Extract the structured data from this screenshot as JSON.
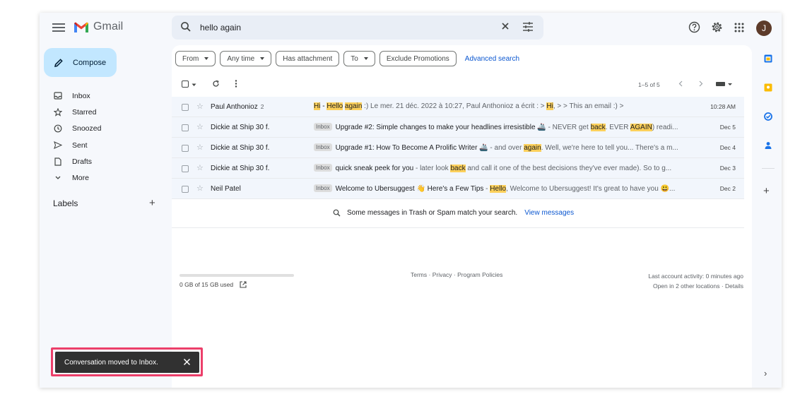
{
  "header": {
    "app_name": "Gmail",
    "search_value": "hello again",
    "avatar_letter": "J",
    "icons": [
      "menu-icon",
      "search-icon",
      "clear-search-icon",
      "search-options-icon",
      "help-icon",
      "settings-icon",
      "apps-icon"
    ]
  },
  "compose": {
    "label": "Compose"
  },
  "nav": {
    "items": [
      {
        "label": "Inbox",
        "icon": "inbox-icon"
      },
      {
        "label": "Starred",
        "icon": "star-icon"
      },
      {
        "label": "Snoozed",
        "icon": "clock-icon"
      },
      {
        "label": "Sent",
        "icon": "send-icon"
      },
      {
        "label": "Drafts",
        "icon": "draft-icon"
      },
      {
        "label": "More",
        "icon": "chevron-down-icon"
      }
    ],
    "labels_heading": "Labels",
    "labels_add": "+"
  },
  "filters": {
    "from": "From",
    "any_time": "Any time",
    "has_attachment": "Has attachment",
    "to": "To",
    "exclude_promotions": "Exclude Promotions",
    "advanced_search": "Advanced search"
  },
  "toolbar": {
    "pager": "1–5 of 5"
  },
  "emails": [
    {
      "sender": "Paul Anthonioz",
      "count": "2",
      "tag": "",
      "parts": [
        [
          "hl",
          "Hi"
        ],
        [
          "",
          " - "
        ],
        [
          "hl",
          "Hello"
        ],
        [
          "",
          " "
        ],
        [
          "hl",
          "again"
        ],
        [
          "snip",
          " :) Le mer. 21 déc. 2022 à 10:27, Paul Anthonioz a écrit : > "
        ],
        [
          "hl",
          "Hi"
        ],
        [
          "snip",
          ", > > This an email :) >"
        ]
      ],
      "date": "10:28 AM"
    },
    {
      "sender": "Dickie at Ship 30 f.",
      "count": "",
      "tag": "Inbox",
      "parts": [
        [
          "",
          "Upgrade #2: Simple changes to make your headlines irresistible 🚢"
        ],
        [
          "snip",
          " - NEVER get "
        ],
        [
          "hl",
          "back"
        ],
        [
          "snip",
          ". EVER "
        ],
        [
          "hl",
          "AGAIN"
        ],
        [
          "snip",
          ") readi..."
        ]
      ],
      "date": "Dec 5"
    },
    {
      "sender": "Dickie at Ship 30 f.",
      "count": "",
      "tag": "Inbox",
      "parts": [
        [
          "",
          "Upgrade #1: How To Become A Prolific Writer 🚢"
        ],
        [
          "snip",
          " - and over "
        ],
        [
          "hl",
          "again"
        ],
        [
          "snip",
          ". Well, we're here to tell you... There's a m..."
        ]
      ],
      "date": "Dec 4"
    },
    {
      "sender": "Dickie at Ship 30 f.",
      "count": "",
      "tag": "Inbox",
      "parts": [
        [
          "",
          "quick sneak peek for you"
        ],
        [
          "snip",
          " - later look "
        ],
        [
          "hl",
          "back"
        ],
        [
          "snip",
          " and call it one of the best decisions they've ever made). So to g..."
        ]
      ],
      "date": "Dec 3"
    },
    {
      "sender": "Neil Patel",
      "count": "",
      "tag": "Inbox",
      "parts": [
        [
          "",
          "Welcome to Ubersuggest 👋 Here's a Few Tips"
        ],
        [
          "snip",
          " - "
        ],
        [
          "hl",
          "Hello"
        ],
        [
          "snip",
          ", Welcome to Ubersuggest! It's great to have you 😃..."
        ]
      ],
      "date": "Dec 2"
    }
  ],
  "spam_note": {
    "text": "Some messages in Trash or Spam match your search.",
    "link": "View messages"
  },
  "footer": {
    "storage": "0 GB of 15 GB used",
    "storage_fraction": 0,
    "links": "Terms · Privacy · Program Policies",
    "activity": "Last account activity: 0 minutes ago",
    "open_locations": "Open in 2 other locations · Details"
  },
  "snackbar": {
    "text": "Conversation moved to Inbox."
  },
  "colors": {
    "accent": "#0b57d0",
    "compose_bg": "#c2e7ff",
    "highlight": "#fcd05b",
    "snackbar_outline": "#ec3f6a"
  }
}
